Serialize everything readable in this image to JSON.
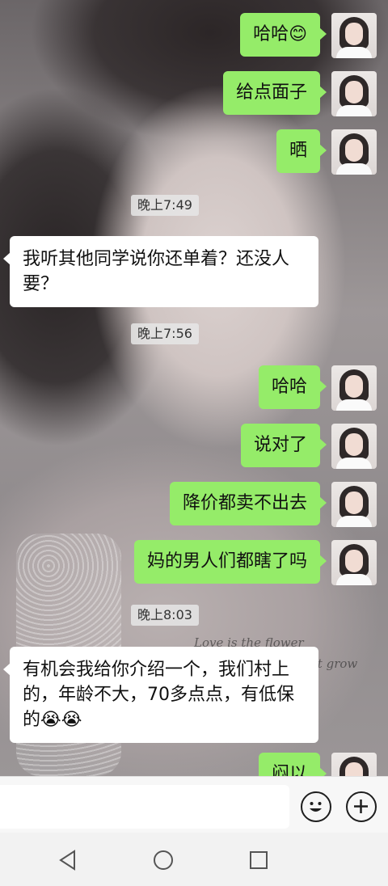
{
  "messages": [
    {
      "side": "me",
      "text": "哈哈😊"
    },
    {
      "side": "me",
      "text": "给点面子"
    },
    {
      "side": "me",
      "text": "晒"
    },
    {
      "side": "time",
      "text": "晚上7:49"
    },
    {
      "side": "them",
      "text": "我听其他同学说你还单着？还没人要？"
    },
    {
      "side": "time",
      "text": "晚上7:56"
    },
    {
      "side": "me",
      "text": "哈哈"
    },
    {
      "side": "me",
      "text": "说对了"
    },
    {
      "side": "me",
      "text": "降价都卖不出去"
    },
    {
      "side": "me",
      "text": "妈的男人们都瞎了吗"
    },
    {
      "side": "time",
      "text": "晚上8:03"
    },
    {
      "side": "them",
      "text": "有机会我给你介绍一个，我们村上的，年龄不大，70多点点，有低保的😭😭"
    },
    {
      "side": "me",
      "text": "闷以"
    }
  ],
  "wallpaper_text": [
    "Love is the flower",
    "it grow"
  ],
  "input": {
    "value": "",
    "placeholder": ""
  },
  "icons": {
    "emoji": "smiley-icon",
    "more": "plus-circle-icon",
    "nav_back": "triangle-back-icon",
    "nav_home": "circle-home-icon",
    "nav_recent": "square-recent-icon"
  },
  "colors": {
    "my_bubble": "#95ec69",
    "their_bubble": "#ffffff",
    "time_badge": "#e6e6e6"
  }
}
